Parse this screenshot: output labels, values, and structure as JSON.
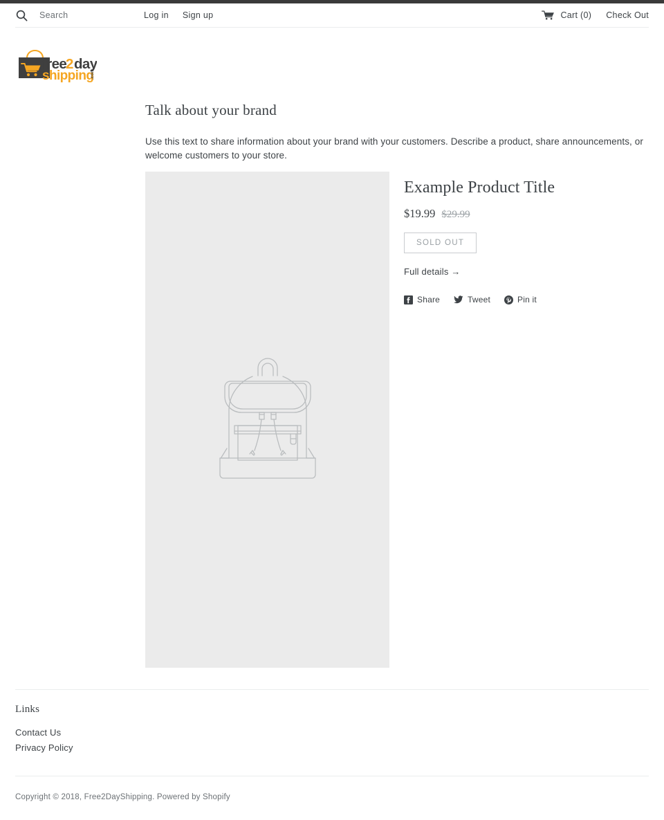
{
  "topbar": {
    "search_icon": "search-icon",
    "search_placeholder": "Search",
    "search_value": "",
    "login_label": "Log in",
    "signup_label": "Sign up",
    "cart_icon": "shopping-cart-icon",
    "cart_label": "Cart (0)",
    "checkout_label": "Check Out"
  },
  "logo": {
    "alt": "free2dayshipping.com",
    "word_free": "free",
    "word_two": "2",
    "word_day": "day",
    "word_shipping": "shipping",
    "word_com": ".com",
    "dark_color": "#3f3f3f",
    "accent_color": "#f5a623"
  },
  "rich_text": {
    "heading": "Talk about your brand",
    "body": "Use this text to share information about your brand with your customers. Describe a product, share announcements, or welcome customers to your store."
  },
  "product": {
    "image_placeholder_icon": "backpack-placeholder-icon",
    "title": "Example Product Title",
    "price": "$19.99",
    "compare_at_price": "$29.99",
    "sold_out_label": "SOLD OUT",
    "full_details_label": "Full details →",
    "share": [
      {
        "icon": "facebook-icon",
        "label": "Share"
      },
      {
        "icon": "twitter-icon",
        "label": "Tweet"
      },
      {
        "icon": "pinterest-icon",
        "label": "Pin it"
      }
    ]
  },
  "footer": {
    "links_heading": "Links",
    "links": [
      {
        "label": "Contact Us"
      },
      {
        "label": "Privacy Policy"
      }
    ],
    "copyright_prefix": "Copyright © 2018, ",
    "store_name": "Free2DayShipping",
    "copyright_middle": ". Powered by ",
    "platform": "Shopify"
  }
}
